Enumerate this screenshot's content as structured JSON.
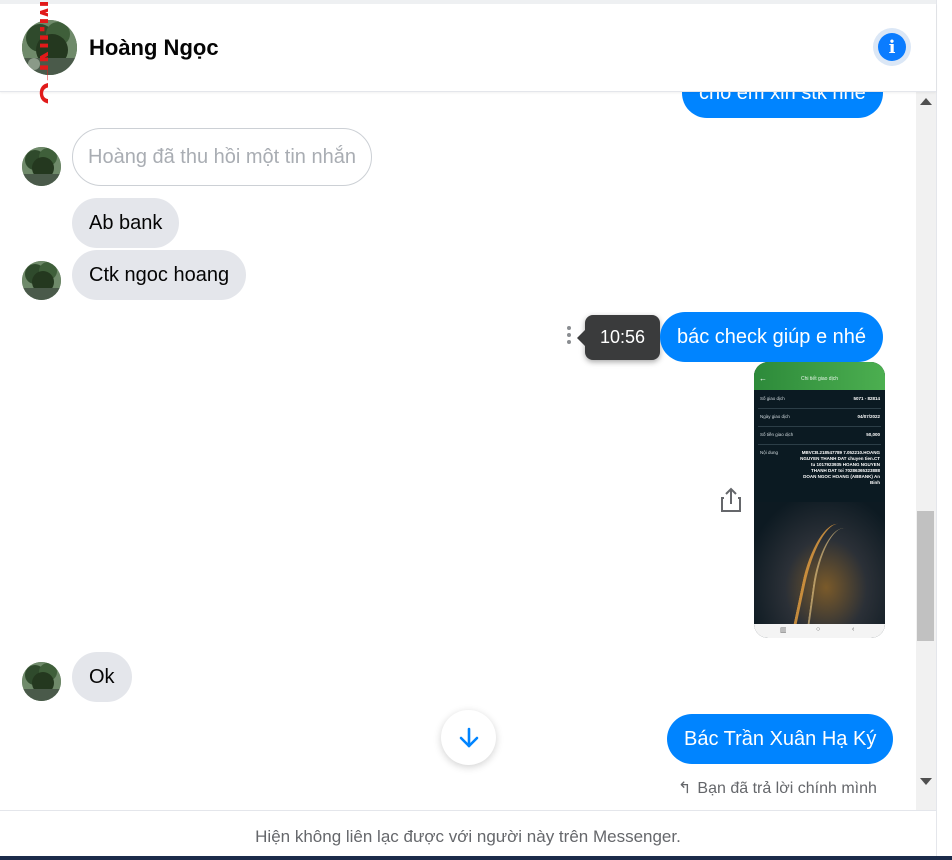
{
  "header": {
    "contact_name": "Hoàng Ngọc",
    "info_icon": "info-icon"
  },
  "watermark": {
    "text": "M.INFO"
  },
  "messages": {
    "partial_top": "cho em xin stk nhé",
    "unsent_notice": "Hoàng đã thu hồi một tin nhắn",
    "in_1": "Ab bank",
    "in_2": "Ctk ngoc hoang",
    "out_1": "bác check giúp e nhé",
    "out_1_time": "10:56",
    "in_3": "Ok",
    "out_2": "Bác Trần Xuân Hạ Ký",
    "reply_note": "Bạn đã trả lời chính mình"
  },
  "receipt": {
    "title": "Chi tiết giao dịch",
    "rows": [
      {
        "label": "Số giao dịch",
        "value": "5071 - 82814"
      },
      {
        "label": "Ngày giao dịch",
        "value": "04/07/2022"
      },
      {
        "label": "Số tiền giao dịch",
        "value": "50,000"
      }
    ],
    "content_label": "Nội dung",
    "content_value": "MBVCB.218547789 7.052210.HOANG NGUYEN THANH DAT chuyen tien.CT tu 1017923935 HOANG NGUYEN THANH DAT toi 70286365323888 DOAN NGOC HOANG (ABBANK) An Binh"
  },
  "footer": {
    "notice": "Hiện không liên lạc được với người này trên Messenger."
  },
  "colors": {
    "accent": "#0084ff",
    "incoming_bubble": "#e4e6eb",
    "tooltip": "#3a3b3c"
  }
}
